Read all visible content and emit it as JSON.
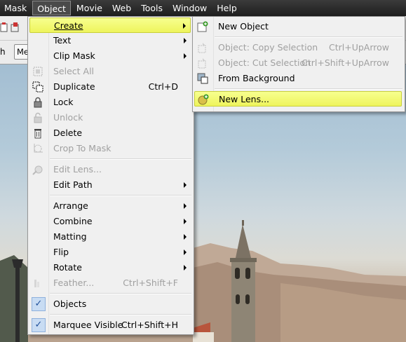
{
  "menubar": {
    "items": [
      {
        "label": "Mask",
        "active": false
      },
      {
        "label": "Object",
        "active": true
      },
      {
        "label": "Movie",
        "active": false
      },
      {
        "label": "Web",
        "active": false
      },
      {
        "label": "Tools",
        "active": false
      },
      {
        "label": "Window",
        "active": false
      },
      {
        "label": "Help",
        "active": false
      }
    ]
  },
  "toolbar": {
    "edge_text": "h",
    "medium_button": "Med"
  },
  "object_menu": {
    "items": [
      {
        "label": "Create",
        "shortcut": "",
        "submenu": true,
        "disabled": false,
        "highlighted": true,
        "icon": ""
      },
      {
        "label": "Text",
        "shortcut": "",
        "submenu": true,
        "disabled": false,
        "icon": ""
      },
      {
        "label": "Clip Mask",
        "shortcut": "",
        "submenu": true,
        "disabled": false,
        "icon": ""
      },
      {
        "label": "Select All",
        "shortcut": "",
        "submenu": false,
        "disabled": true,
        "icon": "select-all-icon"
      },
      {
        "label": "Duplicate",
        "shortcut": "Ctrl+D",
        "submenu": false,
        "disabled": false,
        "icon": "duplicate-icon"
      },
      {
        "label": "Lock",
        "shortcut": "",
        "submenu": false,
        "disabled": false,
        "icon": "lock-icon"
      },
      {
        "label": "Unlock",
        "shortcut": "",
        "submenu": false,
        "disabled": true,
        "icon": "unlock-icon"
      },
      {
        "label": "Delete",
        "shortcut": "",
        "submenu": false,
        "disabled": false,
        "icon": "trash-icon"
      },
      {
        "label": "Crop To Mask",
        "shortcut": "",
        "submenu": false,
        "disabled": true,
        "icon": "crop-to-mask-icon"
      },
      {
        "label": "Edit Lens...",
        "shortcut": "",
        "submenu": false,
        "disabled": true,
        "icon": "edit-lens-icon"
      },
      {
        "label": "Edit Path",
        "shortcut": "",
        "submenu": true,
        "disabled": false,
        "icon": ""
      },
      {
        "label": "Arrange",
        "shortcut": "",
        "submenu": true,
        "disabled": false,
        "icon": ""
      },
      {
        "label": "Combine",
        "shortcut": "",
        "submenu": true,
        "disabled": false,
        "icon": ""
      },
      {
        "label": "Matting",
        "shortcut": "",
        "submenu": true,
        "disabled": false,
        "icon": ""
      },
      {
        "label": "Flip",
        "shortcut": "",
        "submenu": true,
        "disabled": false,
        "icon": ""
      },
      {
        "label": "Rotate",
        "shortcut": "",
        "submenu": true,
        "disabled": false,
        "icon": ""
      },
      {
        "label": "Feather...",
        "shortcut": "Ctrl+Shift+F",
        "submenu": false,
        "disabled": true,
        "icon": "feather-icon"
      },
      {
        "label": "Objects",
        "shortcut": "",
        "submenu": false,
        "disabled": false,
        "checked": true,
        "icon": "checkmark-icon"
      },
      {
        "label": "Marquee Visible",
        "shortcut": "Ctrl+Shift+H",
        "submenu": false,
        "disabled": false,
        "checked": true,
        "icon": "checkmark-icon"
      }
    ]
  },
  "create_submenu": {
    "items": [
      {
        "label": "New Object",
        "shortcut": "",
        "disabled": false,
        "icon": "new-object-icon"
      },
      {
        "label": "Object: Copy Selection",
        "shortcut": "Ctrl+UpArrow",
        "disabled": true,
        "icon": "copy-selection-icon"
      },
      {
        "label": "Object: Cut Selection",
        "shortcut": "Ctrl+Shift+UpArrow",
        "disabled": true,
        "icon": "cut-selection-icon"
      },
      {
        "label": "From Background",
        "shortcut": "",
        "disabled": false,
        "icon": "from-background-icon"
      },
      {
        "label": "New Lens...",
        "shortcut": "",
        "disabled": false,
        "highlighted": true,
        "icon": "new-lens-icon"
      }
    ]
  },
  "colors": {
    "highlight": "#f2f86c",
    "highlight_border": "#c8cf3b",
    "menubar": "#2a2a2a",
    "menu_bg": "#f0f0f0",
    "disabled_text": "#a0a0a0"
  }
}
